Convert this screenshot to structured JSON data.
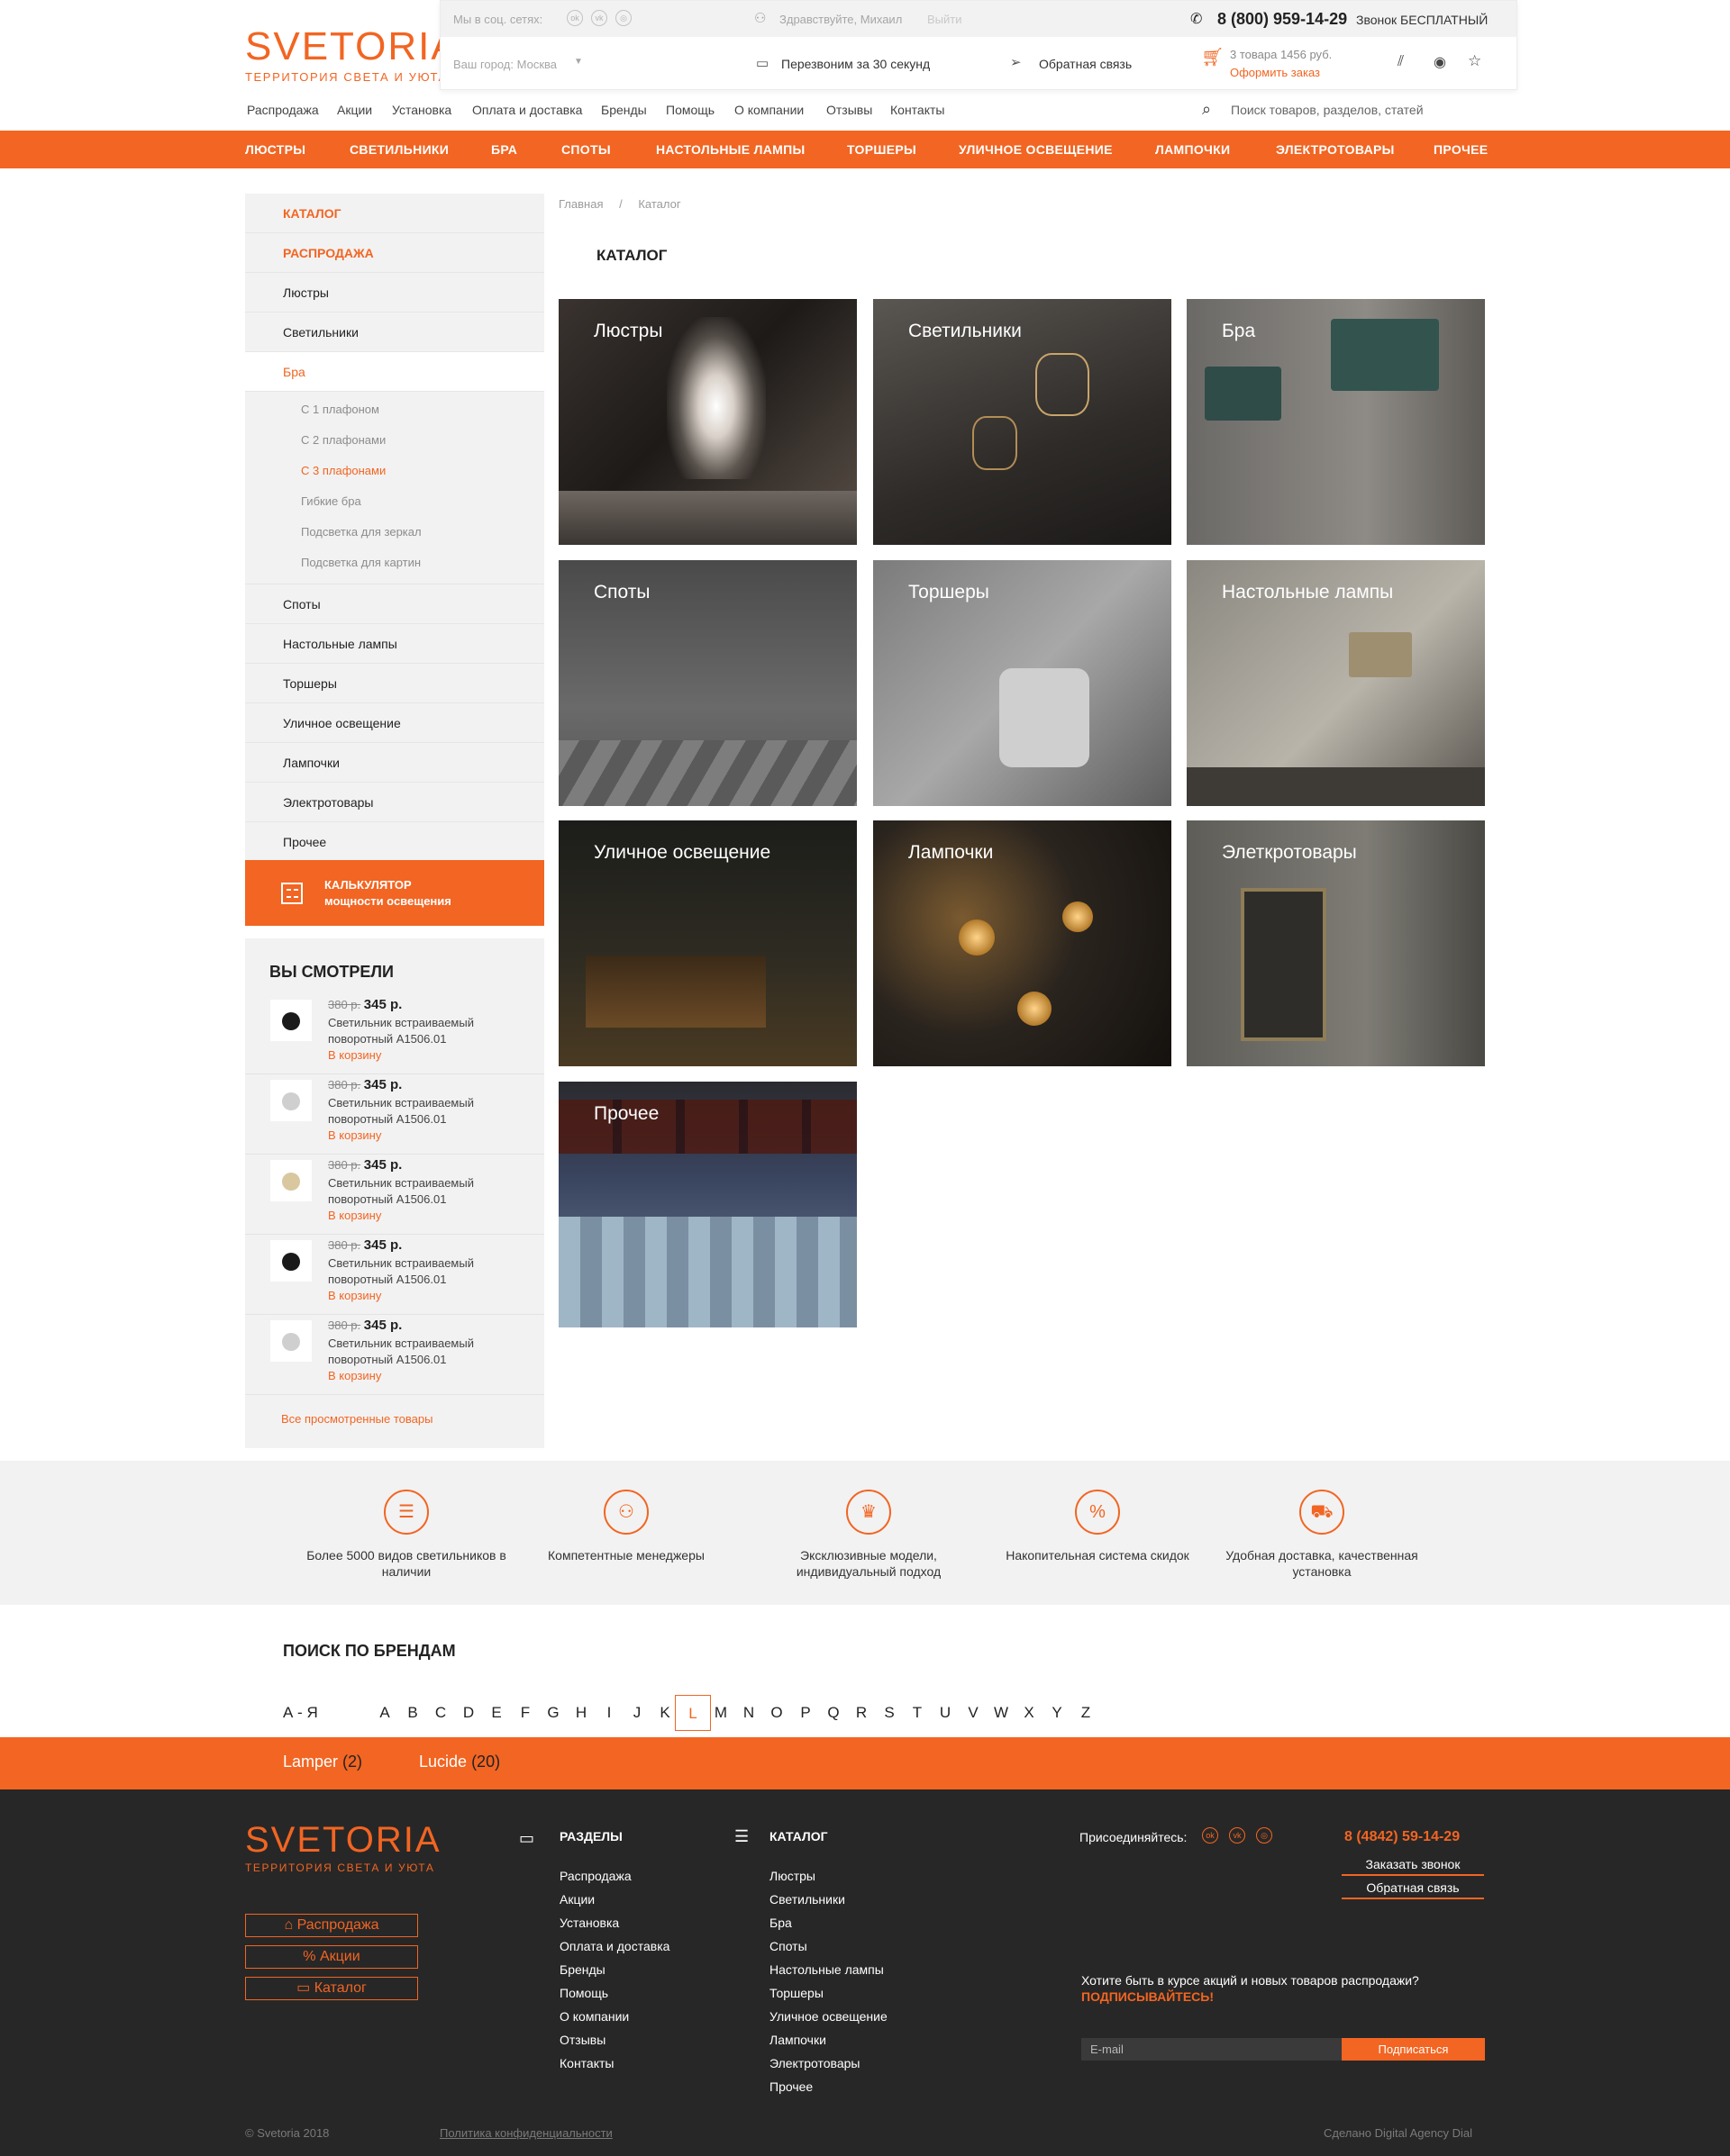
{
  "brand": {
    "logo": "SVETORIA",
    "tagline": "ТЕРРИТОРИЯ СВЕТА И УЮТА"
  },
  "header": {
    "social_label": "Мы в соц. сетях:",
    "greeting": "Здравствуйте, Михаил",
    "logout": "Выйти",
    "phone": "8 (800) 959-14-29",
    "phone_note": "Звонок БЕСПЛАТНЫЙ",
    "city": "Ваш город: Москва",
    "callback": "Перезвоним за 30 секунд",
    "feedback": "Обратная связь",
    "cart_summary": "3 товара 1456 руб.",
    "checkout": "Оформить заказ",
    "search_placeholder": "Поиск товаров, разделов, статей",
    "top_nav": [
      "Распродажа",
      "Акции",
      "Установка",
      "Оплата и доставка",
      "Бренды",
      "Помощь",
      "О компании",
      "Отзывы",
      "Контакты"
    ],
    "categories": [
      "Люстры",
      "Светильники",
      "Бра",
      "Споты",
      "Настольные лампы",
      "Торшеры",
      "Уличное освещение",
      "Лампочки",
      "Электротовары",
      "Прочее"
    ]
  },
  "sidebar": {
    "catalog": "КАТАЛОГ",
    "sale": "РАСПРОДАЖА",
    "items_top": [
      "Люстры",
      "Светильники"
    ],
    "active": "Бра",
    "sub_items": [
      "С 1 плафоном",
      "С 2 плафонами",
      "С 3 плафонами",
      "Гибкие бра",
      "Подсветка для зеркал",
      "Подсветка для картин"
    ],
    "sub_active_index": 2,
    "items_bottom": [
      "Споты",
      "Настольные лампы",
      "Торшеры",
      "Уличное освещение",
      "Лампочки",
      "Электротовары",
      "Прочее"
    ],
    "calc_line1": "КАЛЬКУЛЯТОР",
    "calc_line2": "мощности освещения"
  },
  "viewed": {
    "title": "ВЫ СМОТРЕЛИ",
    "old_price": "380 р.",
    "price": "345 р.",
    "name": "Светильник встраиваемый поворотный A1506.01",
    "cart": "В корзину",
    "all": "Все просмотренные товары",
    "count": 5
  },
  "main": {
    "breadcrumb_home": "Главная",
    "breadcrumb_sep": "/",
    "breadcrumb_current": "Каталог",
    "title": "КАТАЛОГ",
    "tiles": [
      "Люстры",
      "Светильники",
      "Бра",
      "Споты",
      "Торшеры",
      "Настольные лампы",
      "Уличное освещение",
      "Лампочки",
      "Элеткротовары",
      "Прочее"
    ]
  },
  "features": [
    "Более 5000 видов светильников в наличии",
    "Компетентные менеджеры",
    "Эксклюзивные модели, индивидуальный подход",
    "Накопительная система скидок",
    "Удобная доставка, качественная установка"
  ],
  "brands": {
    "title": "ПОИСК ПО БРЕНДАМ",
    "cyr": "А - Я",
    "letters": [
      "A",
      "B",
      "C",
      "D",
      "E",
      "F",
      "G",
      "H",
      "I",
      "J",
      "K",
      "L",
      "M",
      "N",
      "O",
      "P",
      "Q",
      "R",
      "S",
      "T",
      "U",
      "V",
      "W",
      "X",
      "Y",
      "Z"
    ],
    "active_letter": "L",
    "results": [
      {
        "name": "Lamper",
        "count": "(2)"
      },
      {
        "name": "Lucide",
        "count": "(20)"
      }
    ]
  },
  "footer": {
    "buttons": [
      "Распродажа",
      "Акции",
      "Каталог"
    ],
    "sections_title": "РАЗДЕЛЫ",
    "sections": [
      "Распродажа",
      "Акции",
      "Установка",
      "Оплата и доставка",
      "Бренды",
      "Помощь",
      "О компании",
      "Отзывы",
      "Контакты"
    ],
    "catalog_title": "КАТАЛОГ",
    "catalog": [
      "Люстры",
      "Светильники",
      "Бра",
      "Споты",
      "Настольные лампы",
      "Торшеры",
      "Уличное освещение",
      "Лампочки",
      "Электротовары",
      "Прочее"
    ],
    "join": "Присоединяйтесь:",
    "phone": "8 (4842) 59-14-29",
    "order_call": "Заказать звонок",
    "feedback": "Обратная связь",
    "subscribe_text": "Хотите быть в курсе акций и новых товаров распродажи?",
    "subscribe_cta": "ПОДПИСЫВАЙТЕСЬ!",
    "email_placeholder": "E-mail",
    "subscribe_button": "Подписаться",
    "copyright": "© Svetoria 2018",
    "policy": "Политика конфиденциальности",
    "made_by": "Сделано Digital Agency Dial"
  },
  "colors": {
    "accent": "#f26522",
    "footer_bg": "#272727",
    "panel_bg": "#f2f2f2"
  }
}
